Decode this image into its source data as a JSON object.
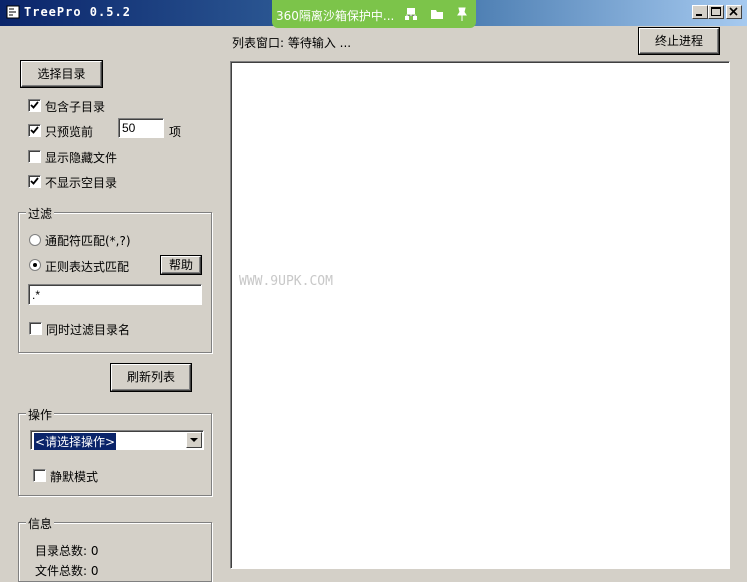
{
  "window": {
    "title": "TreePro 0.5.2"
  },
  "sandbox": {
    "text": "360隔离沙箱保护中...",
    "icons": [
      "sandbox-network-icon",
      "folder-icon",
      "pin-icon"
    ]
  },
  "status": {
    "list_window": "列表窗口: 等待输入 ..."
  },
  "buttons": {
    "stop": "终止进程",
    "choose_dir": "选择目录",
    "help": "帮助",
    "refresh": "刷新列表"
  },
  "options": {
    "include_subdirs": {
      "label": "包含子目录",
      "checked": true
    },
    "preview_only": {
      "label": "只预览前",
      "checked": true,
      "value": "50",
      "unit": "项"
    },
    "show_hidden": {
      "label": "显示隐藏文件",
      "checked": false
    },
    "hide_empty": {
      "label": "不显示空目录",
      "checked": true
    }
  },
  "filter": {
    "title": "过滤",
    "wildcard": {
      "label": "通配符匹配(*,?)",
      "selected": false
    },
    "regex": {
      "label": "正则表达式匹配",
      "selected": true
    },
    "pattern_value": ".*",
    "filter_dirs": {
      "label": "同时过滤目录名",
      "checked": false
    }
  },
  "operation": {
    "title": "操作",
    "selected": "<请选择操作>",
    "silent": {
      "label": "静默模式",
      "checked": false
    }
  },
  "info": {
    "title": "信息",
    "dir_count": "目录总数: 0",
    "file_count": "文件总数: 0"
  },
  "listpane": {
    "watermark": "WWW.9UPK.COM"
  }
}
